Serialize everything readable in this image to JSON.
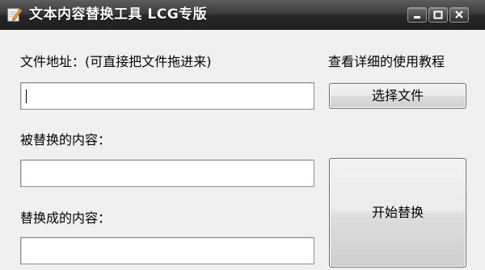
{
  "window": {
    "title": "文本内容替换工具 LCG专版",
    "icon": "pencil-app-icon",
    "controls": [
      "minimize-icon",
      "maximize-icon",
      "close-icon"
    ]
  },
  "form": {
    "path_label": "文件地址：(可直接把文件拖进来)",
    "path_value": "",
    "help_link": "查看详细的使用教程",
    "select_button": "选择文件",
    "find_label": "被替换的内容：",
    "find_value": "",
    "replace_label": "替换成的内容：",
    "replace_value": "",
    "start_button": "开始替换"
  },
  "colors": {
    "titlebar": "#2b2b2b",
    "title_text": "#ffffff",
    "background": "#f0f0f0"
  }
}
